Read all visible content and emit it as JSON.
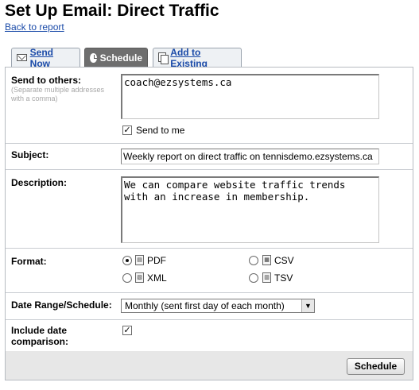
{
  "page": {
    "title": "Set Up Email: Direct Traffic",
    "back_link": "Back to report"
  },
  "tabs": [
    {
      "label": "Send Now",
      "icon": "envelope-icon",
      "active": false
    },
    {
      "label": "Schedule",
      "icon": "clock-icon",
      "active": true
    },
    {
      "label": "Add to Existing",
      "icon": "copy-icon",
      "active": false
    }
  ],
  "form": {
    "send_to_others": {
      "label": "Send to others:",
      "hint": "(Separate multiple addresses with a comma)",
      "value": "coach@ezsystems.ca"
    },
    "send_to_me": {
      "label": "Send to me",
      "checked": true
    },
    "subject": {
      "label": "Subject:",
      "value": "Weekly report on direct traffic on tennisdemo.ezsystems.ca"
    },
    "description": {
      "label": "Description:",
      "value": "We can compare website traffic trends\nwith an increase in membership."
    },
    "format": {
      "label": "Format:",
      "options": [
        {
          "label": "PDF",
          "selected": true,
          "icon": "pdf-icon"
        },
        {
          "label": "CSV",
          "selected": false,
          "icon": "csv-icon"
        },
        {
          "label": "XML",
          "selected": false,
          "icon": "xml-icon"
        },
        {
          "label": "TSV",
          "selected": false,
          "icon": "tsv-icon"
        }
      ]
    },
    "date_range": {
      "label": "Date Range/Schedule:",
      "selected": "Monthly (sent first day of each month)"
    },
    "include_comparison": {
      "label": "Include date comparison:",
      "checked": true
    }
  },
  "footer": {
    "schedule_button": "Schedule"
  }
}
